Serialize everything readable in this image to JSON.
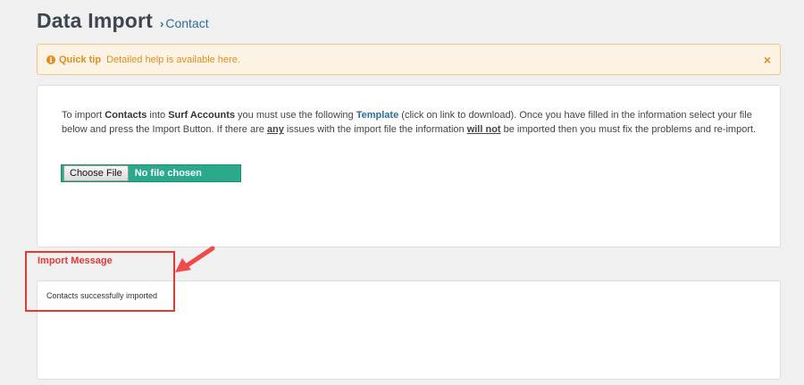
{
  "header": {
    "title": "Data Import",
    "breadcrumb_chevron": "›",
    "breadcrumb": "Contact"
  },
  "alert": {
    "title": "Quick tip",
    "text": "Detailed help is available here.",
    "close": "×"
  },
  "instructions": {
    "t1": "To import ",
    "b1": "Contacts",
    "t2": " into ",
    "b2": "Surf Accounts",
    "t3": " you must use the following ",
    "link": "Template",
    "t4": " (click on link to download). Once you have filled in the information select your file below and press the Import Button. If there are ",
    "u1": "any",
    "t5": " issues with the import file the information ",
    "u2": "will not",
    "t6": " be imported then you must fix the problems and re-import."
  },
  "file_input": {
    "button_label": "Choose File",
    "status": "No file chosen"
  },
  "import_message": {
    "label": "Import Message",
    "text": "Contacts successfully imported"
  },
  "colors": {
    "title": "#3d4650",
    "link": "#2a6f97",
    "alert": "#e08e1f",
    "file_picker": "#2aa98b",
    "highlight": "#e53935"
  }
}
